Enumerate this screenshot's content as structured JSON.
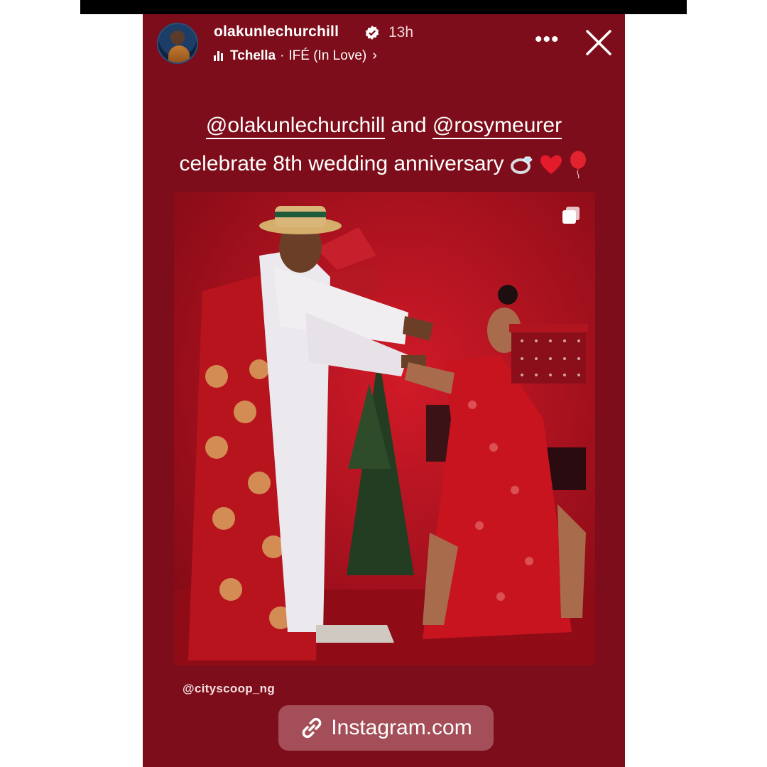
{
  "story": {
    "username": "olakunlechurchill",
    "verified": true,
    "time": "13h",
    "music": {
      "artist": "Tchella",
      "separator": "·",
      "song": "IFÉ (In Love)",
      "chevron": "›"
    },
    "more_label": "•••",
    "caption": {
      "mention1": "@olakunlechurchill",
      "connector": " and ",
      "mention2": "@rosymeurer",
      "line2": "celebrate 8th wedding anniversary"
    },
    "credit": "@cityscoop_ng",
    "link_sticker": "Instagram.com"
  },
  "colors": {
    "background": "#7d0d1a",
    "photo_red": "#c4141f",
    "text": "#ffffff"
  },
  "icons": [
    "verified-badge-icon",
    "music-bars-icon",
    "chevron-right-icon",
    "more-icon",
    "close-icon",
    "ring-emoji-icon",
    "red-heart-emoji-icon",
    "balloon-emoji-icon",
    "carousel-icon",
    "link-icon"
  ]
}
